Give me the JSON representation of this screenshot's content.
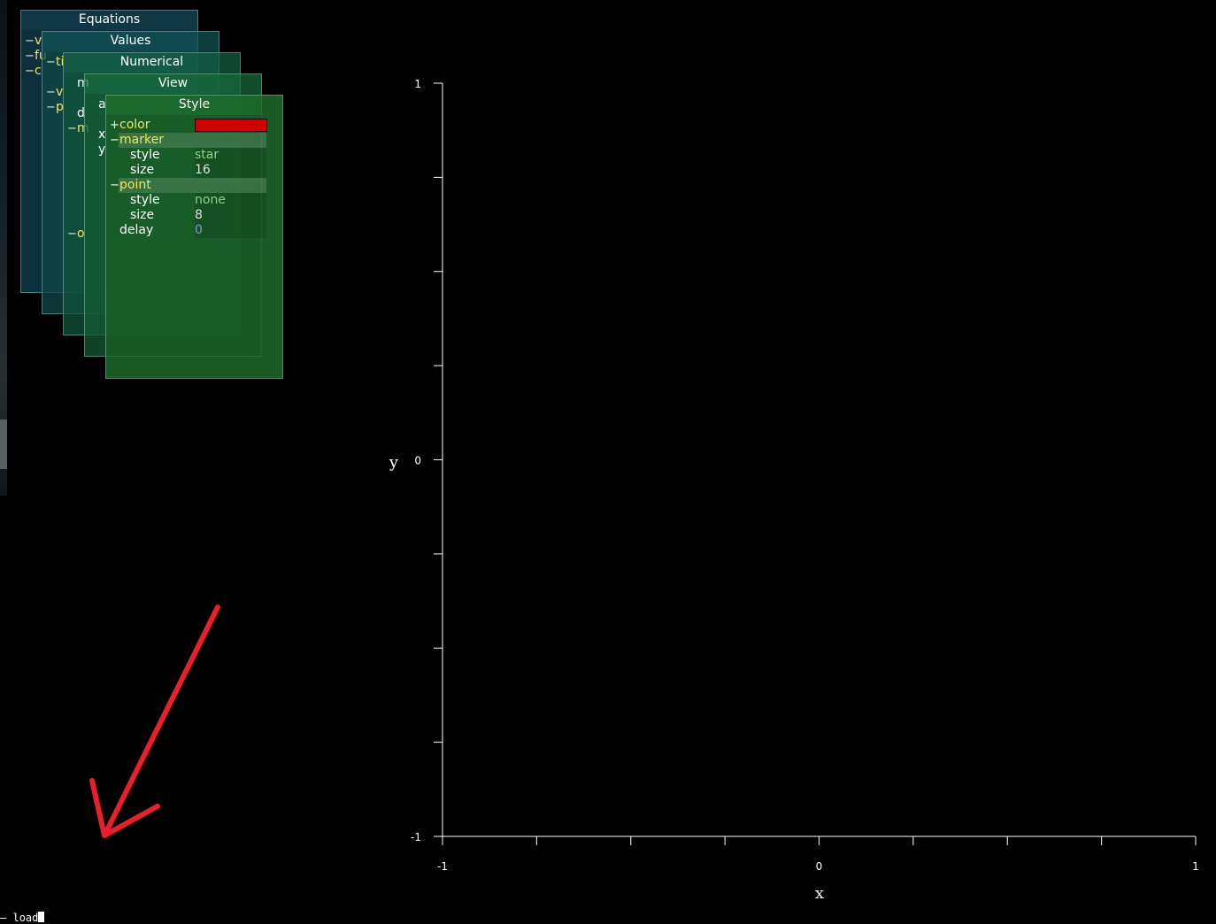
{
  "panels": {
    "equations": {
      "title": "Equations",
      "frags": [
        "v",
        "fu",
        "c"
      ]
    },
    "values": {
      "title": "Values",
      "frags": [
        "ti",
        "v",
        "p"
      ]
    },
    "numerical": {
      "title": "Numerical",
      "frags": [
        "m",
        "d",
        "m",
        "o"
      ]
    },
    "view": {
      "title": "View",
      "frags": [
        "a",
        "x",
        "y"
      ]
    },
    "style": {
      "title": "Style",
      "rows": [
        {
          "toggle": "+",
          "label": "color",
          "swatch": "#d00000"
        },
        {
          "toggle": "−",
          "label": "marker"
        },
        {
          "label": "style",
          "value": "star"
        },
        {
          "label": "size",
          "value": "16"
        },
        {
          "toggle": "−",
          "label": "point"
        },
        {
          "label": "style",
          "value": "none"
        },
        {
          "label": "size",
          "value": "8"
        },
        {
          "label": "delay",
          "value": "0"
        }
      ]
    },
    "toggle_minus": "−"
  },
  "plot": {
    "xlabel": "x",
    "ylabel": "y",
    "xlim": [
      -1,
      1
    ],
    "ylim": [
      -1,
      1
    ],
    "xticks_labeled": [
      "-1",
      "0",
      "1"
    ],
    "yticks_labeled": [
      "1",
      "0",
      "-1"
    ],
    "minor_ticks_per_side": 8,
    "axis_color": "#ffffff"
  },
  "annotation": {
    "type": "arrow",
    "color": "#e8202a",
    "points_to": "command-line"
  },
  "command_line": {
    "prompt": "–",
    "text": "load"
  }
}
